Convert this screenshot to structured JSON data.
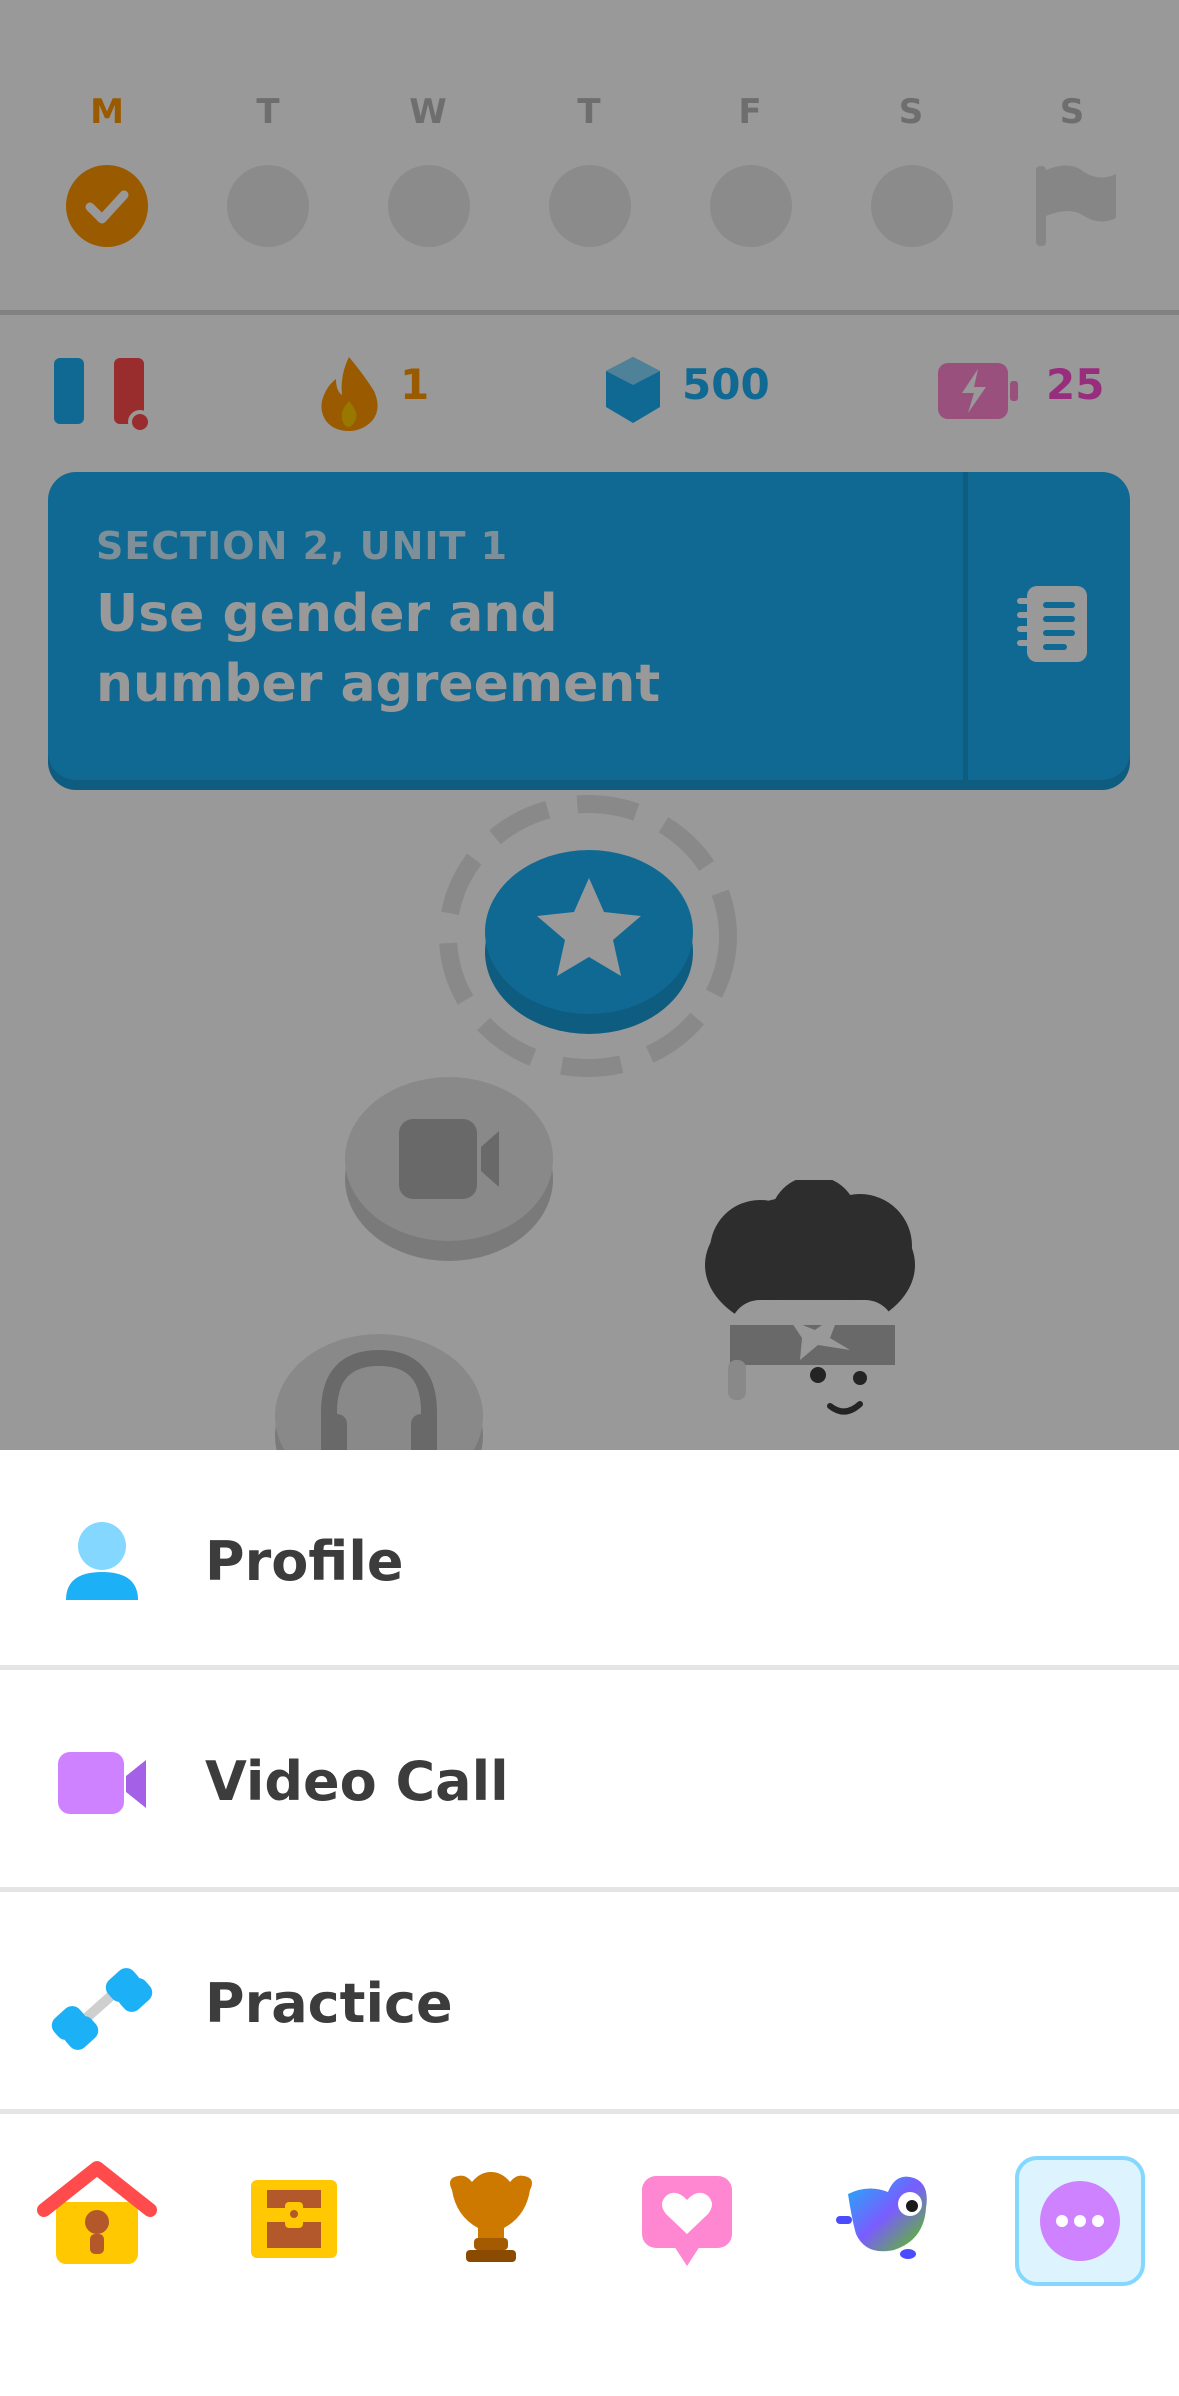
{
  "week": {
    "days": [
      "M",
      "T",
      "W",
      "T",
      "F",
      "S",
      "S"
    ],
    "completed_day": "M",
    "goal_icon": "flag-icon"
  },
  "stats": {
    "language_flag": "french-flag-icon",
    "streak": "1",
    "gems": "500",
    "energy": "25"
  },
  "unit": {
    "section": "SECTION 2, UNIT 1",
    "title_line1": "Use gender and",
    "title_line2": "number agreement",
    "guidebook_icon": "guidebook-icon"
  },
  "menu": {
    "items": [
      {
        "label": "Profile",
        "icon": "profile-icon"
      },
      {
        "label": "Video Call",
        "icon": "video-camera-icon"
      },
      {
        "label": "Practice",
        "icon": "dumbbell-icon"
      }
    ]
  },
  "nav": {
    "items": [
      "home-icon",
      "chest-icon",
      "leaderboard-icon",
      "heart-message-icon",
      "duo-bird-icon",
      "more-icon"
    ],
    "active": "more-icon"
  },
  "colors": {
    "accent_orange": "#ff9600",
    "accent_blue": "#1cb0f6",
    "accent_purple": "#ce82ff",
    "text_dark": "#3c3c3c"
  }
}
